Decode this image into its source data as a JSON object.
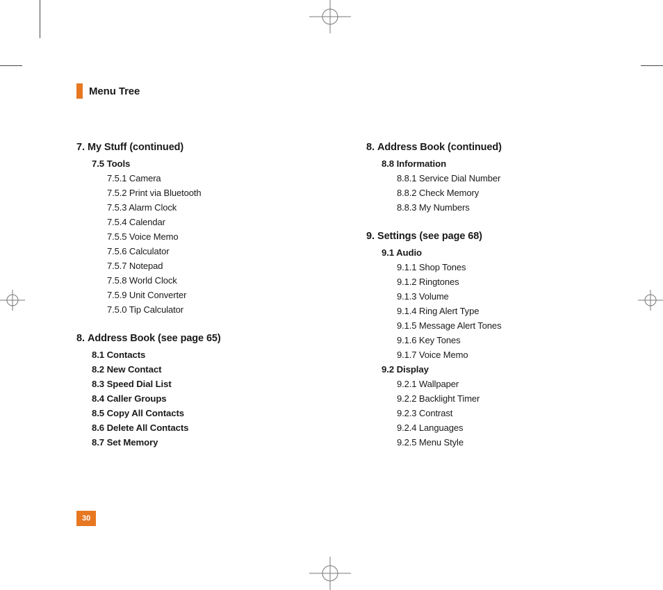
{
  "title": "Menu Tree",
  "pageNumber": "30",
  "left": {
    "s1": {
      "num": "7.",
      "title": "My Stuff (continued)",
      "sub1": "7.5 Tools",
      "items": [
        "7.5.1 Camera",
        "7.5.2 Print via Bluetooth",
        "7.5.3 Alarm Clock",
        "7.5.4 Calendar",
        "7.5.5 Voice Memo",
        "7.5.6 Calculator",
        "7.5.7 Notepad",
        "7.5.8 World Clock",
        "7.5.9 Unit Converter",
        "7.5.0 Tip Calculator"
      ]
    },
    "s2": {
      "num": "8.",
      "title": "Address Book (see page 65)",
      "subs": [
        "8.1 Contacts",
        "8.2 New Contact",
        "8.3 Speed Dial List",
        "8.4 Caller Groups",
        "8.5 Copy All Contacts",
        "8.6 Delete All Contacts",
        "8.7 Set Memory"
      ]
    }
  },
  "right": {
    "s1": {
      "num": "8.",
      "title": "Address Book (continued)",
      "sub1": "8.8 Information",
      "items": [
        "8.8.1 Service Dial Number",
        "8.8.2 Check Memory",
        "8.8.3 My Numbers"
      ]
    },
    "s2": {
      "num": "9.",
      "title": "Settings (see page 68)",
      "sub1": "9.1 Audio",
      "items1": [
        "9.1.1 Shop Tones",
        "9.1.2 Ringtones",
        "9.1.3 Volume",
        "9.1.4 Ring Alert Type",
        "9.1.5 Message Alert Tones",
        "9.1.6 Key Tones",
        "9.1.7 Voice Memo"
      ],
      "sub2": "9.2 Display",
      "items2": [
        "9.2.1 Wallpaper",
        "9.2.2 Backlight Timer",
        "9.2.3 Contrast",
        "9.2.4 Languages",
        "9.2.5 Menu Style"
      ]
    }
  }
}
